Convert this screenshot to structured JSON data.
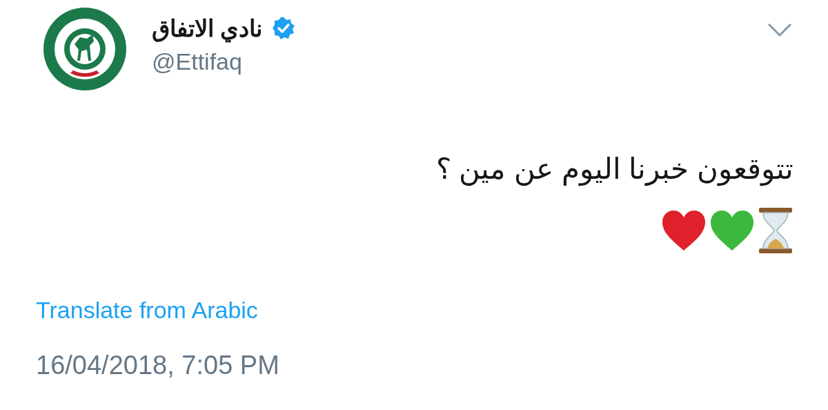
{
  "tweet": {
    "author": {
      "name": "نادي الاتفاق",
      "verified": true,
      "handle": "@Ettifaq"
    },
    "text": "تتوقعون خبرنا اليوم عن مين ؟",
    "emojis": [
      {
        "kind": "hourglass"
      },
      {
        "kind": "heart",
        "color": "#3cb83c"
      },
      {
        "kind": "heart",
        "color": "#e0202a"
      }
    ],
    "translate_link": "Translate from Arabic",
    "timestamp": "16/04/2018, 7:05 PM"
  }
}
